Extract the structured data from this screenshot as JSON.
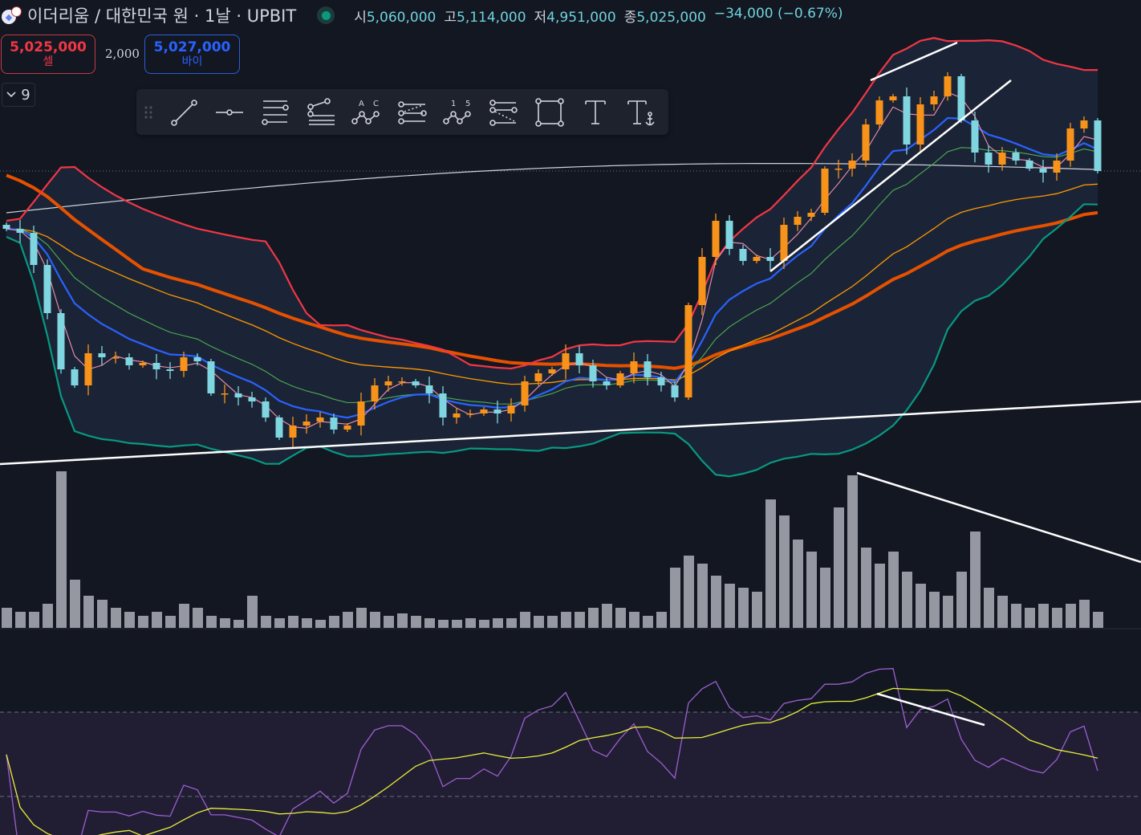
{
  "header": {
    "symbol_title": "이더리움 / 대한민국 원 · 1날 · UPBIT",
    "ohlc": [
      {
        "label": "시",
        "value": "5,060,000"
      },
      {
        "label": "고",
        "value": "5,114,000"
      },
      {
        "label": "저",
        "value": "4,951,000"
      },
      {
        "label": "종",
        "value": "5,025,000"
      }
    ],
    "change": "−34,000 (−0.67%)",
    "market_status": "open"
  },
  "trade": {
    "sell_price": "5,025,000",
    "sell_label": "셀",
    "spread": "2,000",
    "buy_price": "5,027,000",
    "buy_label": "바이"
  },
  "indicators_toggle": {
    "count": "9"
  },
  "toolbar": {
    "tools": [
      "trend-line",
      "horizontal-ray",
      "pitchfork-lines",
      "fib-retracement",
      "abcd-pattern",
      "fib-channel",
      "elliott-wave",
      "fib-speed",
      "rectangle",
      "text",
      "anchored-text"
    ],
    "labels": {
      "abcd_a": "A",
      "abcd_c": "C",
      "wave_1": "1",
      "wave_5": "5",
      "text_t": "T"
    }
  },
  "colors": {
    "background": "#131722",
    "up_candle": "#f7931a",
    "down_candle": "#7fd6e0",
    "ma_fast": "#f48fb1",
    "bb_upper": "#f23645",
    "bb_lower": "#089981",
    "bb_basis": "#2962ff",
    "ma_mid": "#4caf50",
    "ma_long": "#ff9800",
    "ma_200": "#e65100",
    "ma_white": "#d1d4dc",
    "volume": "#9598a1",
    "rsi": "#9c5fd0",
    "rsi_signal": "#e8f03a"
  },
  "chart_data": {
    "type": "candlestick",
    "current_price": 5025000,
    "closes": [
      4809000,
      4794000,
      4674000,
      4494000,
      4284000,
      4224000,
      4344000,
      4329000,
      4329000,
      4299000,
      4308000,
      4284000,
      4278000,
      4329000,
      4314000,
      4194000,
      4194000,
      4179000,
      4164000,
      4104000,
      4029000,
      4074000,
      4089000,
      4104000,
      4059000,
      4074000,
      4164000,
      4224000,
      4239000,
      4239000,
      4224000,
      4194000,
      4104000,
      4119000,
      4119000,
      4134000,
      4119000,
      4149000,
      4239000,
      4269000,
      4284000,
      4344000,
      4299000,
      4239000,
      4224000,
      4269000,
      4314000,
      4254000,
      4224000,
      4179000,
      4524000,
      4704000,
      4839000,
      4734000,
      4689000,
      4704000,
      4689000,
      4824000,
      4854000,
      4869000,
      5034000,
      5034000,
      5064000,
      5199000,
      5289000,
      5304000,
      5124000,
      5274000,
      5304000,
      5379000,
      5214000,
      5094000,
      5049000,
      5094000,
      5064000,
      5034000,
      5019000,
      5064000,
      5184000,
      5214000,
      5025000
    ],
    "volumes": [
      25,
      20,
      20,
      30,
      195,
      60,
      40,
      35,
      25,
      20,
      15,
      20,
      15,
      30,
      25,
      15,
      12,
      10,
      40,
      15,
      12,
      15,
      12,
      10,
      15,
      20,
      25,
      20,
      15,
      18,
      15,
      12,
      10,
      10,
      12,
      10,
      12,
      12,
      20,
      15,
      15,
      20,
      20,
      25,
      30,
      25,
      20,
      15,
      20,
      75,
      90,
      80,
      65,
      55,
      50,
      45,
      160,
      140,
      110,
      95,
      75,
      150,
      190,
      100,
      80,
      95,
      70,
      55,
      45,
      40,
      70,
      120,
      50,
      40,
      30,
      25,
      30,
      25,
      30,
      35,
      20
    ],
    "rsi_levels": [
      70,
      30
    ]
  }
}
